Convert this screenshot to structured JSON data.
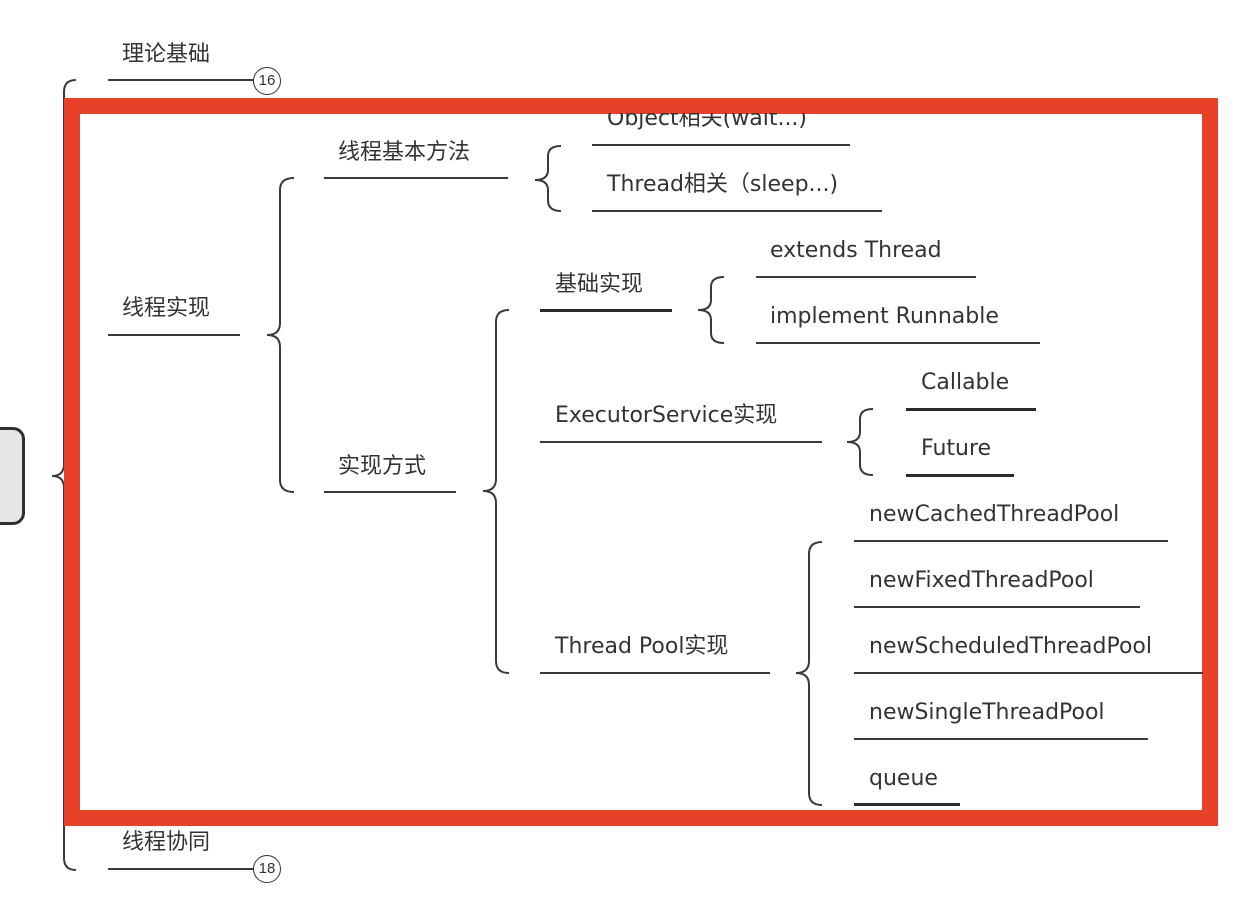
{
  "root_node": {
    "label": "",
    "state": "collapsed-box"
  },
  "top_level": [
    {
      "id": "theory",
      "label": "理论基础",
      "child_count": "16"
    },
    {
      "id": "impl",
      "label": "线程实现"
    },
    {
      "id": "coop",
      "label": "线程协同",
      "child_count": "18"
    }
  ],
  "highlight": {
    "color": "#e8412a"
  },
  "impl_children": {
    "basic_methods": {
      "label": "线程基本方法",
      "children": [
        "Object相关(wait...)",
        "Thread相关（sleep...)"
      ]
    },
    "approaches": {
      "label": "实现方式",
      "basic": {
        "label": "基础实现",
        "children": [
          "extends Thread",
          "implement Runnable"
        ]
      },
      "executor": {
        "label": "ExecutorService实现",
        "children": [
          "Callable",
          "Future"
        ]
      },
      "pool": {
        "label": "Thread Pool实现",
        "children": [
          "newCachedThreadPool",
          "newFixedThreadPool",
          "newScheduledThreadPool",
          "newSingleThreadPool",
          "queue"
        ]
      }
    }
  }
}
